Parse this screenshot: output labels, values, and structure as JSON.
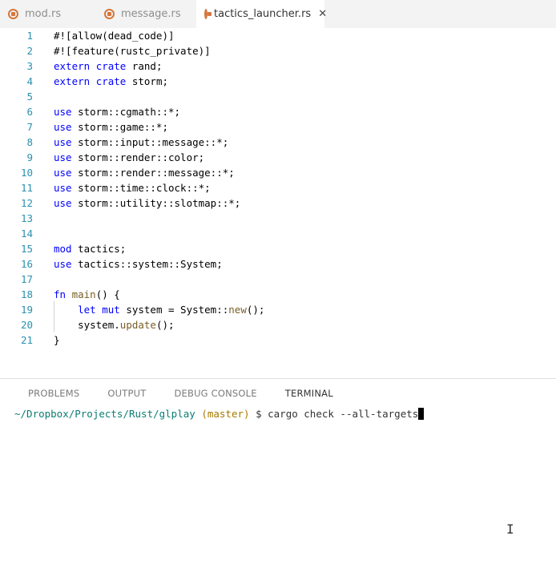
{
  "tabs": [
    {
      "label": "mod.rs",
      "active": false,
      "icon": "rust-file-icon"
    },
    {
      "label": "message.rs",
      "active": false,
      "icon": "rust-file-icon"
    },
    {
      "label": "tactics_launcher.rs",
      "active": true,
      "icon": "rust-file-icon",
      "close": "✕"
    }
  ],
  "editor": {
    "lines": [
      {
        "n": "1",
        "parts": [
          {
            "t": "#![allow(dead_code)]",
            "c": ""
          }
        ]
      },
      {
        "n": "2",
        "parts": [
          {
            "t": "#![feature(rustc_private)]",
            "c": ""
          }
        ]
      },
      {
        "n": "3",
        "parts": [
          {
            "t": "extern",
            "c": "kw"
          },
          {
            "t": " ",
            "c": ""
          },
          {
            "t": "crate",
            "c": "kw"
          },
          {
            "t": " rand;",
            "c": ""
          }
        ]
      },
      {
        "n": "4",
        "parts": [
          {
            "t": "extern",
            "c": "kw"
          },
          {
            "t": " ",
            "c": ""
          },
          {
            "t": "crate",
            "c": "kw"
          },
          {
            "t": " storm;",
            "c": ""
          }
        ]
      },
      {
        "n": "5",
        "parts": []
      },
      {
        "n": "6",
        "parts": [
          {
            "t": "use",
            "c": "kw"
          },
          {
            "t": " storm::cgmath::*;",
            "c": ""
          }
        ]
      },
      {
        "n": "7",
        "parts": [
          {
            "t": "use",
            "c": "kw"
          },
          {
            "t": " storm::game::*;",
            "c": ""
          }
        ]
      },
      {
        "n": "8",
        "parts": [
          {
            "t": "use",
            "c": "kw"
          },
          {
            "t": " storm::input::message::*;",
            "c": ""
          }
        ]
      },
      {
        "n": "9",
        "parts": [
          {
            "t": "use",
            "c": "kw"
          },
          {
            "t": " storm::render::color;",
            "c": ""
          }
        ]
      },
      {
        "n": "10",
        "parts": [
          {
            "t": "use",
            "c": "kw"
          },
          {
            "t": " storm::render::message::*;",
            "c": ""
          }
        ]
      },
      {
        "n": "11",
        "parts": [
          {
            "t": "use",
            "c": "kw"
          },
          {
            "t": " storm::time::clock::*;",
            "c": ""
          }
        ]
      },
      {
        "n": "12",
        "parts": [
          {
            "t": "use",
            "c": "kw"
          },
          {
            "t": " storm::utility::slotmap::*;",
            "c": ""
          }
        ]
      },
      {
        "n": "13",
        "parts": []
      },
      {
        "n": "14",
        "parts": []
      },
      {
        "n": "15",
        "parts": [
          {
            "t": "mod",
            "c": "kw"
          },
          {
            "t": " tactics;",
            "c": ""
          }
        ]
      },
      {
        "n": "16",
        "parts": [
          {
            "t": "use",
            "c": "kw"
          },
          {
            "t": " tactics::system::System;",
            "c": ""
          }
        ]
      },
      {
        "n": "17",
        "parts": []
      },
      {
        "n": "18",
        "parts": [
          {
            "t": "fn",
            "c": "kw"
          },
          {
            "t": " ",
            "c": ""
          },
          {
            "t": "main",
            "c": "fnc"
          },
          {
            "t": "() {",
            "c": ""
          }
        ]
      },
      {
        "n": "19",
        "parts": [
          {
            "t": "    ",
            "c": ""
          },
          {
            "t": "let",
            "c": "kw"
          },
          {
            "t": " ",
            "c": ""
          },
          {
            "t": "mut",
            "c": "kw"
          },
          {
            "t": " system = System::",
            "c": ""
          },
          {
            "t": "new",
            "c": "fnc"
          },
          {
            "t": "();",
            "c": ""
          }
        ]
      },
      {
        "n": "20",
        "parts": [
          {
            "t": "    system.",
            "c": ""
          },
          {
            "t": "update",
            "c": "fnc"
          },
          {
            "t": "();",
            "c": ""
          }
        ]
      },
      {
        "n": "21",
        "parts": [
          {
            "t": "}",
            "c": ""
          }
        ]
      }
    ]
  },
  "panel": {
    "tabs": [
      "PROBLEMS",
      "OUTPUT",
      "DEBUG CONSOLE",
      "TERMINAL"
    ],
    "active_tab": "TERMINAL",
    "terminal": {
      "path": "~/Dropbox/Projects/Rust/glplay",
      "branch": "(master)",
      "prompt_symbol": "$",
      "command": "cargo check --all-targets"
    }
  },
  "colors": {
    "keyword": "#0000ff",
    "function": "#795e26",
    "line_number": "#2b91af",
    "terminal_path": "#0b7d73",
    "terminal_branch": "#a57a00"
  }
}
